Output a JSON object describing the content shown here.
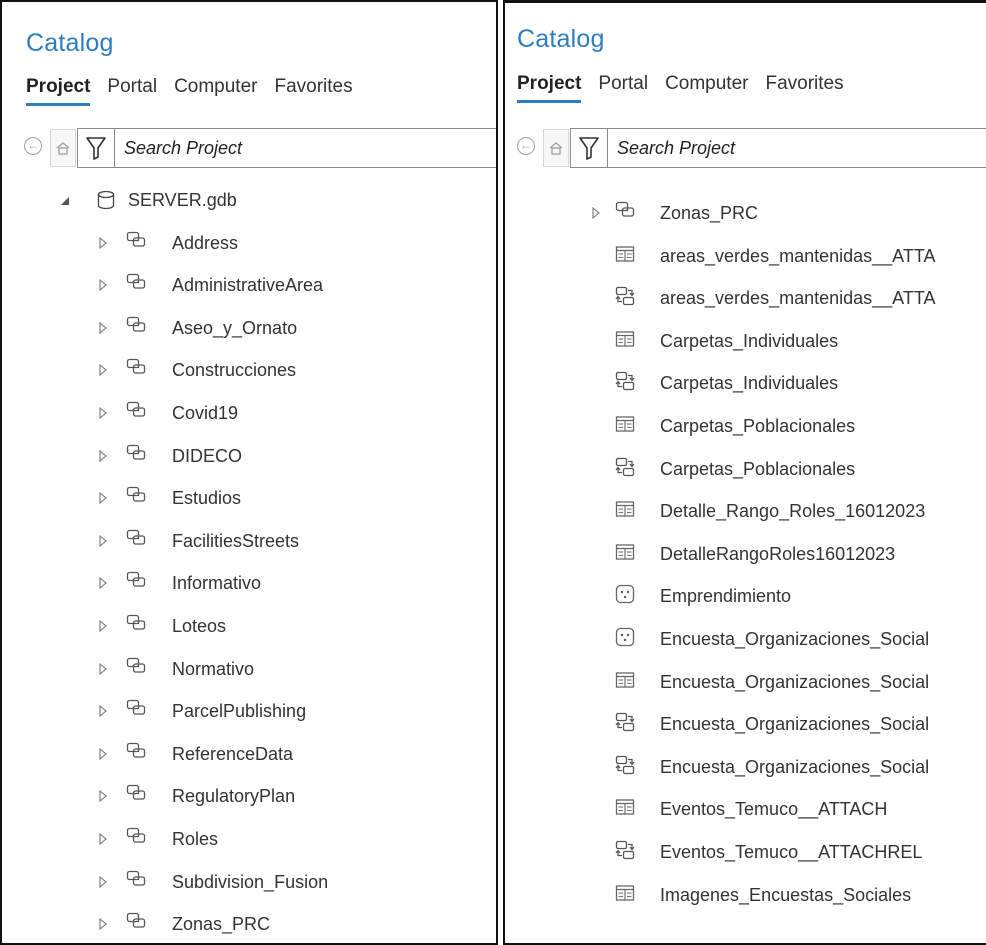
{
  "colors": {
    "accent": "#2e7dc2",
    "text": "#333333",
    "border": "#111111"
  },
  "left_panel": {
    "title": "Catalog",
    "tabs": [
      "Project",
      "Portal",
      "Computer",
      "Favorites"
    ],
    "active_tab": "Project",
    "search_placeholder": "Search Project",
    "root": {
      "label": "SERVER.gdb",
      "icon": "geodatabase-icon",
      "expanded": true
    },
    "items": [
      "Address",
      "AdministrativeArea",
      "Aseo_y_Ornato",
      "Construcciones",
      "Covid19",
      "DIDECO",
      "Estudios",
      "FacilitiesStreets",
      "Informativo",
      "Loteos",
      "Normativo",
      "ParcelPublishing",
      "ReferenceData",
      "RegulatoryPlan",
      "Roles",
      "Subdivision_Fusion",
      "Zonas_PRC"
    ],
    "item_icon": "feature-dataset-icon"
  },
  "right_panel": {
    "title": "Catalog",
    "tabs": [
      "Project",
      "Portal",
      "Computer",
      "Favorites"
    ],
    "active_tab": "Project",
    "search_placeholder": "Search Project",
    "items": [
      {
        "label": "Zonas_PRC",
        "icon": "feature-dataset-icon",
        "expandable": true
      },
      {
        "label": "areas_verdes_mantenidas__ATTA",
        "icon": "table-icon"
      },
      {
        "label": "areas_verdes_mantenidas__ATTA",
        "icon": "relationship-class-icon"
      },
      {
        "label": "Carpetas_Individuales",
        "icon": "table-icon"
      },
      {
        "label": "Carpetas_Individuales",
        "icon": "relationship-class-icon"
      },
      {
        "label": "Carpetas_Poblacionales",
        "icon": "table-icon"
      },
      {
        "label": "Carpetas_Poblacionales",
        "icon": "relationship-class-icon"
      },
      {
        "label": "Detalle_Rango_Roles_16012023",
        "icon": "table-icon"
      },
      {
        "label": "DetalleRangoRoles16012023",
        "icon": "table-icon"
      },
      {
        "label": "Emprendimiento",
        "icon": "point-feature-class-icon"
      },
      {
        "label": "Encuesta_Organizaciones_Social",
        "icon": "point-feature-class-icon"
      },
      {
        "label": "Encuesta_Organizaciones_Social",
        "icon": "table-icon"
      },
      {
        "label": "Encuesta_Organizaciones_Social",
        "icon": "relationship-class-icon"
      },
      {
        "label": "Encuesta_Organizaciones_Social",
        "icon": "relationship-class-icon"
      },
      {
        "label": "Eventos_Temuco__ATTACH",
        "icon": "table-icon"
      },
      {
        "label": "Eventos_Temuco__ATTACHREL",
        "icon": "relationship-class-icon"
      },
      {
        "label": "Imagenes_Encuestas_Sociales",
        "icon": "table-icon"
      }
    ]
  }
}
